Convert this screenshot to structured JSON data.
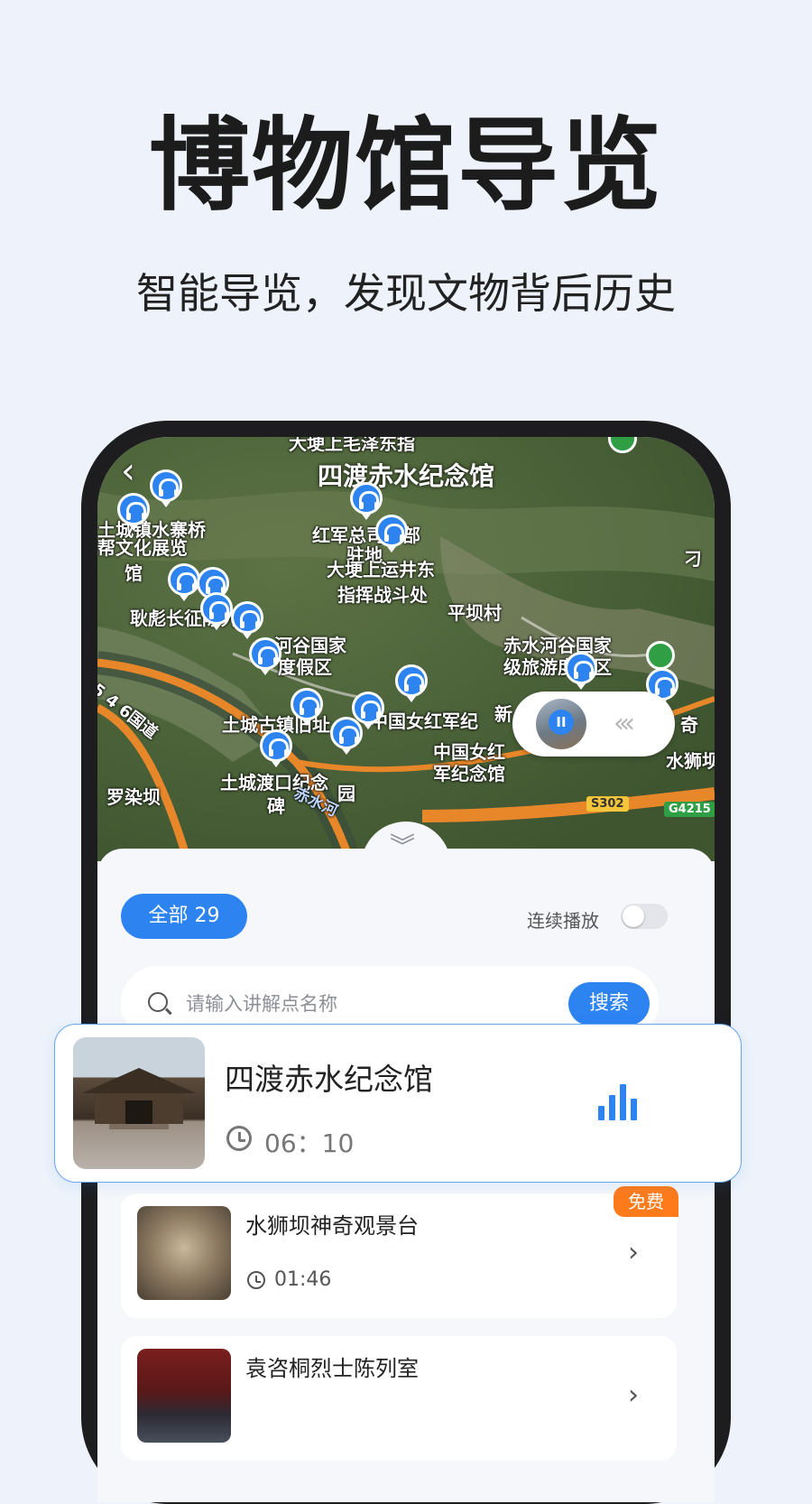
{
  "promo": {
    "headline": "博物馆导览",
    "subline": "智能导览，发现文物背后历史"
  },
  "map": {
    "title": "四渡赤水纪念馆",
    "back_icon": "chevron-left-icon",
    "labels": [
      "大埂上毛泽东指",
      "红军总司令部",
      "驻地",
      "大埂上运井东",
      "指挥战斗处",
      "平坝村",
      "土城镇水寨桥",
      "帮文化展览",
      "馆",
      "耿彪长征陈列",
      "赤水河谷国家",
      "级旅游度假区",
      "河谷国家",
      "度假区",
      "土城古镇旧址",
      "中国女红军纪",
      "中国女红",
      "军纪念馆",
      "土城渡口纪念",
      "碑",
      "罗染坝",
      "新",
      "水狮坝",
      "奇",
      "刁",
      "5 4 6国道",
      "赤水河",
      "园"
    ],
    "road_badges": [
      "S302",
      "G4215"
    ],
    "player": {
      "state": "playing",
      "icon": "pause-icon",
      "arrows_icon": "chevrons-left-icon"
    },
    "colors": {
      "pin": "#2d83f0",
      "green_pin": "#2f9e44",
      "road": "#e8872a"
    }
  },
  "sheet": {
    "collapse_icon": "chevron-double-down-icon",
    "filter_all": "全部 29",
    "continuous_play": {
      "label": "连续播放",
      "enabled": false
    },
    "search": {
      "placeholder": "请输入讲解点名称",
      "value": "",
      "button": "搜索"
    }
  },
  "featured": {
    "title": "四渡赤水纪念馆",
    "time": "06：10",
    "playing_icon": "audio-wave-icon"
  },
  "list": [
    {
      "title": "水狮坝神奇观景台",
      "time": "01:46",
      "badge": "免费"
    },
    {
      "title": "袁咨桐烈士陈列室",
      "time": "",
      "badge": ""
    }
  ],
  "colors": {
    "accent": "#2d83f0",
    "badge_orange": "#ff7a1a",
    "background": "#eef3fb"
  }
}
